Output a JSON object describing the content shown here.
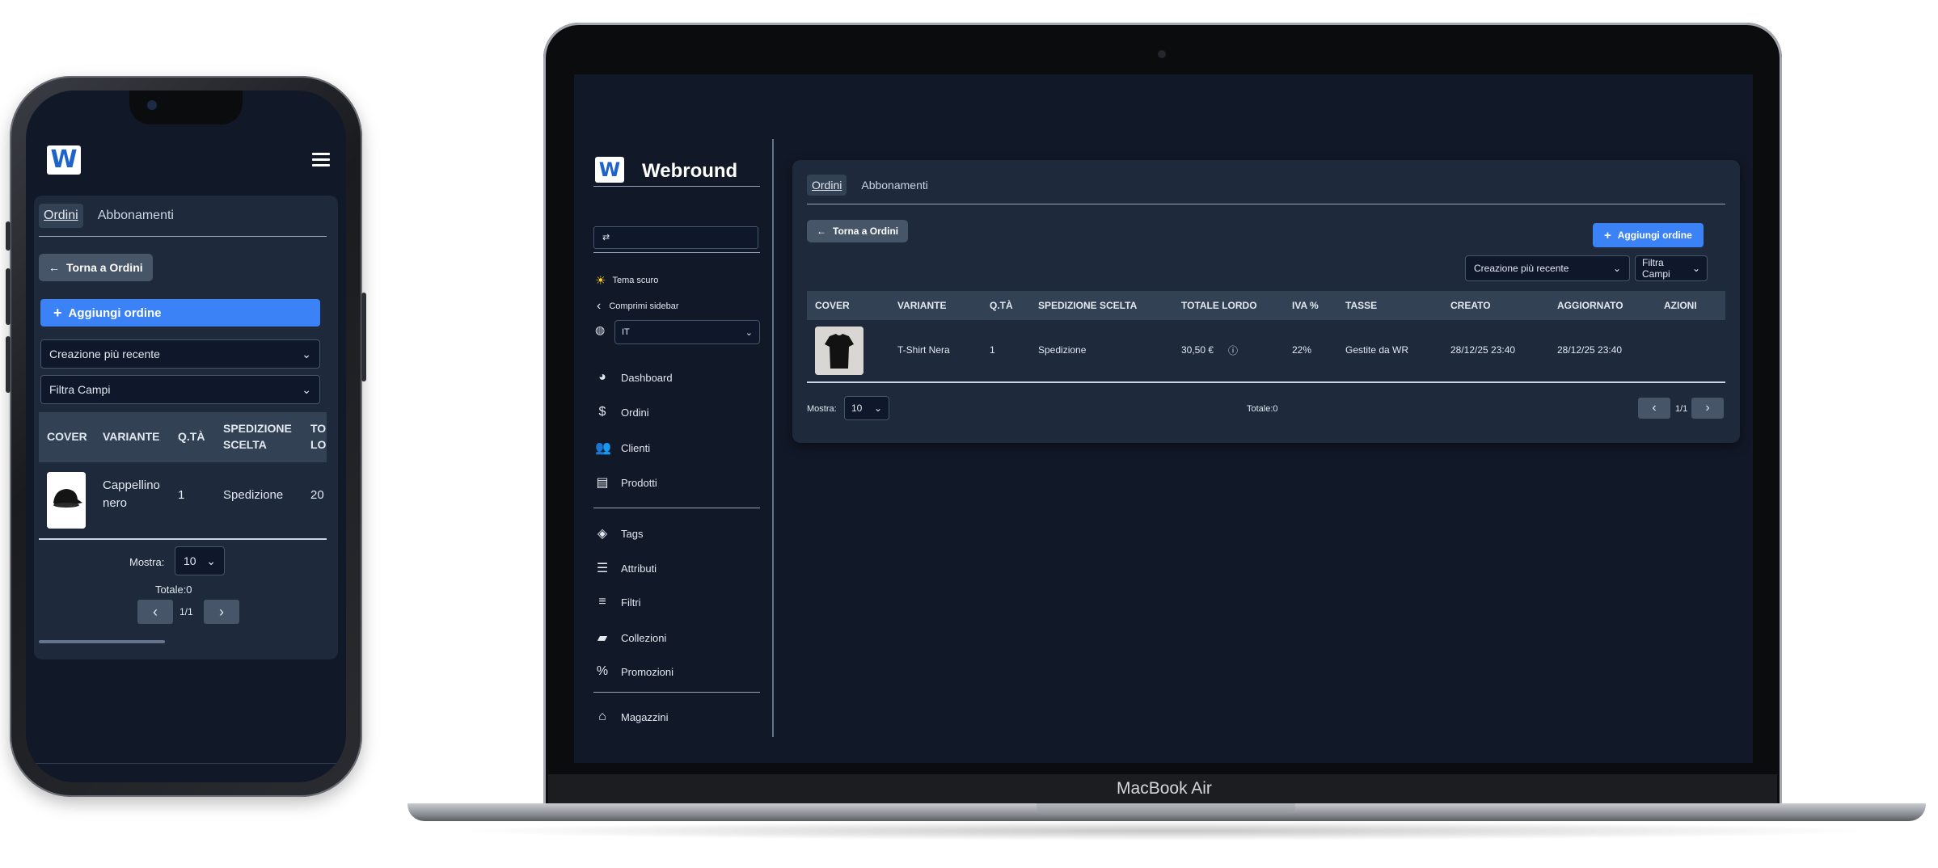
{
  "app": {
    "name": "Webround",
    "logo_letter": "W"
  },
  "device_label": "MacBook Air",
  "tabs": [
    {
      "label": "Ordini",
      "active": true
    },
    {
      "label": "Abbonamenti",
      "active": false
    }
  ],
  "actions": {
    "back_label": "Torna a Ordini",
    "add_label": "Aggiungi ordine"
  },
  "filters": {
    "sort_selected": "Creazione più recente",
    "fields_selected": "Filtra Campi"
  },
  "sidebar": {
    "theme_label": "Tema scuro",
    "collapse_label": "Comprimi sidebar",
    "language_selected": "IT",
    "items": [
      {
        "label": "Dashboard",
        "icon": "pie-chart-icon"
      },
      {
        "label": "Ordini",
        "icon": "dollar-icon"
      },
      {
        "label": "Clienti",
        "icon": "users-icon"
      },
      {
        "label": "Prodotti",
        "icon": "boxes-icon"
      },
      {
        "label": "Tags",
        "icon": "tag-icon"
      },
      {
        "label": "Attributi",
        "icon": "list-ordered-icon"
      },
      {
        "label": "Filtri",
        "icon": "filter-lines-icon"
      },
      {
        "label": "Collezioni",
        "icon": "folder-open-icon"
      },
      {
        "label": "Promozioni",
        "icon": "percent-icon"
      },
      {
        "label": "Magazzini",
        "icon": "warehouse-icon"
      }
    ]
  },
  "table": {
    "columns": [
      "COVER",
      "VARIANTE",
      "Q.TÀ",
      "SPEDIZIONE SCELTA",
      "TOTALE LORDO",
      "IVA %",
      "TASSE",
      "CREATO",
      "AGGIORNATO",
      "AZIONI"
    ],
    "mobile_columns": [
      "COVER",
      "VARIANTE",
      "Q.TÀ",
      "SPEDIZIONE",
      "SCELTA",
      "TO",
      "LO"
    ],
    "desktop_row": {
      "variant": "T-Shirt Nera",
      "qty": "1",
      "shipping": "Spedizione",
      "total": "30,50 €",
      "vat": "22%",
      "taxes": "Gestite da WR",
      "created": "28/12/25 23:40",
      "updated": "28/12/25 23:40"
    },
    "mobile_row": {
      "variant_line1": "Cappellino",
      "variant_line2": "nero",
      "qty": "1",
      "shipping": "Spedizione",
      "total_partial": "20"
    }
  },
  "pagination": {
    "show_label": "Mostra:",
    "per_page": "10",
    "total_label": "Totale:0",
    "page": "1/1"
  },
  "colors": {
    "background": "#111827",
    "card": "#1e293b",
    "accent": "#3b82f6",
    "secondary_button": "#475569",
    "logo_blue": "#1d63c9"
  }
}
